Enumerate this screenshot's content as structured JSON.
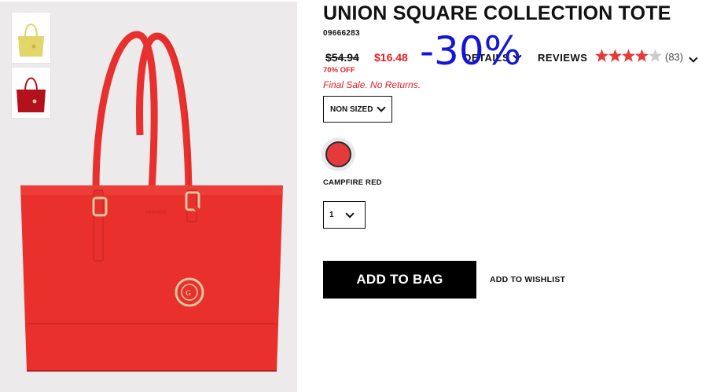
{
  "product": {
    "title": "UNION SQUARE COLLECTION TOTE",
    "sku": "09666283",
    "price_original": "$54.94",
    "price_sale": "$16.48",
    "percent_off": "70% OFF",
    "final_sale_note": "Final Sale. No Returns.",
    "discount_overlay": "-30%"
  },
  "tabs": {
    "details_label": "DETAILS",
    "reviews_label": "REVIEWS",
    "rating": 4,
    "rating_max": 5,
    "review_count": "(83)"
  },
  "options": {
    "size_selected": "NON SIZED",
    "color_name": "CAMPFIRE RED",
    "color_hex": "#e53a3a",
    "quantity_selected": "1"
  },
  "actions": {
    "add_to_bag_label": "ADD TO BAG",
    "add_to_wishlist_label": "ADD TO WISHLIST"
  },
  "thumbnails": [
    {
      "color": "yellow",
      "hex": "#e2d56a"
    },
    {
      "color": "red",
      "hex": "#b3121d"
    }
  ],
  "colors": {
    "sale_red": "#e31e24",
    "star_color": "#e53a3a",
    "button_black": "#000000"
  }
}
